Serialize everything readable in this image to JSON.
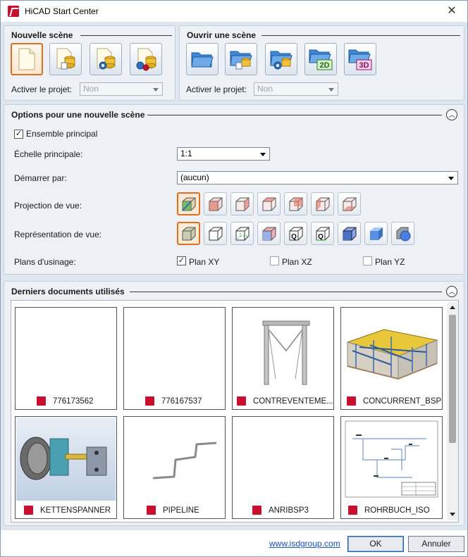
{
  "window": {
    "title": "HiCAD Start Center",
    "close_glyph": "✕"
  },
  "new_scene": {
    "title": "Nouvelle scène",
    "project_label": "Activer le projet:",
    "project_value": "Non",
    "buttons": [
      "new-blank-scene",
      "new-scene-from-template",
      "new-scene-configured",
      "new-scene-multi"
    ]
  },
  "open_scene": {
    "title": "Ouvrir une scène",
    "project_label": "Activer le projet:",
    "project_value": "Non",
    "buttons": [
      "open-folder",
      "open-from-template",
      "open-configured",
      "open-2d",
      "open-3d"
    ],
    "badge_2d": "2D",
    "badge_3d": "3D"
  },
  "options": {
    "title": "Options pour une nouvelle scène",
    "ensemble_label": "Ensemble principal",
    "ensemble_checked": true,
    "echelle_label": "Échelle principale:",
    "echelle_value": "1:1",
    "demarrer_label": "Démarrer par:",
    "demarrer_value": "(aucun)",
    "projection_label": "Projection de vue:",
    "representation_label": "Représentation de vue:",
    "plans_label": "Plans d'usinage:",
    "plan_xy": "Plan XY",
    "plan_xz": "Plan XZ",
    "plan_yz": "Plan YZ",
    "plan_xy_checked": true,
    "plan_xz_checked": false,
    "plan_yz_checked": false
  },
  "recent": {
    "title": "Derniers documents utilisés",
    "documents": [
      {
        "name": "776173562",
        "thumb": "blank"
      },
      {
        "name": "776167537",
        "thumb": "blank"
      },
      {
        "name": "CONTREVENTEME...",
        "thumb": "frame"
      },
      {
        "name": "CONCURRENT_BSP",
        "thumb": "building"
      },
      {
        "name": "KETTENSPANNER",
        "thumb": "tensioner"
      },
      {
        "name": "PIPELINE",
        "thumb": "pipe"
      },
      {
        "name": "ANRIBSP3",
        "thumb": "blank"
      },
      {
        "name": "ROHRBUCH_ISO",
        "thumb": "drawing"
      }
    ]
  },
  "footer": {
    "link": "www.isdgroup.com",
    "ok": "OK",
    "cancel": "Annuler"
  },
  "colors": {
    "accent_selected": "#e07020",
    "brand_red": "#c8102e",
    "link_blue": "#1a4fb5",
    "panel_bg": "#edf1f6"
  }
}
